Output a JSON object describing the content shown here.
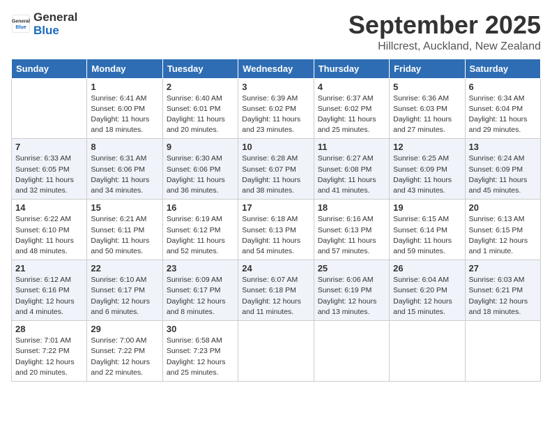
{
  "header": {
    "logo_general": "General",
    "logo_blue": "Blue",
    "month": "September 2025",
    "location": "Hillcrest, Auckland, New Zealand"
  },
  "weekdays": [
    "Sunday",
    "Monday",
    "Tuesday",
    "Wednesday",
    "Thursday",
    "Friday",
    "Saturday"
  ],
  "weeks": [
    [
      {
        "day": "",
        "text": ""
      },
      {
        "day": "1",
        "text": "Sunrise: 6:41 AM\nSunset: 6:00 PM\nDaylight: 11 hours\nand 18 minutes."
      },
      {
        "day": "2",
        "text": "Sunrise: 6:40 AM\nSunset: 6:01 PM\nDaylight: 11 hours\nand 20 minutes."
      },
      {
        "day": "3",
        "text": "Sunrise: 6:39 AM\nSunset: 6:02 PM\nDaylight: 11 hours\nand 23 minutes."
      },
      {
        "day": "4",
        "text": "Sunrise: 6:37 AM\nSunset: 6:02 PM\nDaylight: 11 hours\nand 25 minutes."
      },
      {
        "day": "5",
        "text": "Sunrise: 6:36 AM\nSunset: 6:03 PM\nDaylight: 11 hours\nand 27 minutes."
      },
      {
        "day": "6",
        "text": "Sunrise: 6:34 AM\nSunset: 6:04 PM\nDaylight: 11 hours\nand 29 minutes."
      }
    ],
    [
      {
        "day": "7",
        "text": "Sunrise: 6:33 AM\nSunset: 6:05 PM\nDaylight: 11 hours\nand 32 minutes."
      },
      {
        "day": "8",
        "text": "Sunrise: 6:31 AM\nSunset: 6:06 PM\nDaylight: 11 hours\nand 34 minutes."
      },
      {
        "day": "9",
        "text": "Sunrise: 6:30 AM\nSunset: 6:06 PM\nDaylight: 11 hours\nand 36 minutes."
      },
      {
        "day": "10",
        "text": "Sunrise: 6:28 AM\nSunset: 6:07 PM\nDaylight: 11 hours\nand 38 minutes."
      },
      {
        "day": "11",
        "text": "Sunrise: 6:27 AM\nSunset: 6:08 PM\nDaylight: 11 hours\nand 41 minutes."
      },
      {
        "day": "12",
        "text": "Sunrise: 6:25 AM\nSunset: 6:09 PM\nDaylight: 11 hours\nand 43 minutes."
      },
      {
        "day": "13",
        "text": "Sunrise: 6:24 AM\nSunset: 6:09 PM\nDaylight: 11 hours\nand 45 minutes."
      }
    ],
    [
      {
        "day": "14",
        "text": "Sunrise: 6:22 AM\nSunset: 6:10 PM\nDaylight: 11 hours\nand 48 minutes."
      },
      {
        "day": "15",
        "text": "Sunrise: 6:21 AM\nSunset: 6:11 PM\nDaylight: 11 hours\nand 50 minutes."
      },
      {
        "day": "16",
        "text": "Sunrise: 6:19 AM\nSunset: 6:12 PM\nDaylight: 11 hours\nand 52 minutes."
      },
      {
        "day": "17",
        "text": "Sunrise: 6:18 AM\nSunset: 6:13 PM\nDaylight: 11 hours\nand 54 minutes."
      },
      {
        "day": "18",
        "text": "Sunrise: 6:16 AM\nSunset: 6:13 PM\nDaylight: 11 hours\nand 57 minutes."
      },
      {
        "day": "19",
        "text": "Sunrise: 6:15 AM\nSunset: 6:14 PM\nDaylight: 11 hours\nand 59 minutes."
      },
      {
        "day": "20",
        "text": "Sunrise: 6:13 AM\nSunset: 6:15 PM\nDaylight: 12 hours\nand 1 minute."
      }
    ],
    [
      {
        "day": "21",
        "text": "Sunrise: 6:12 AM\nSunset: 6:16 PM\nDaylight: 12 hours\nand 4 minutes."
      },
      {
        "day": "22",
        "text": "Sunrise: 6:10 AM\nSunset: 6:17 PM\nDaylight: 12 hours\nand 6 minutes."
      },
      {
        "day": "23",
        "text": "Sunrise: 6:09 AM\nSunset: 6:17 PM\nDaylight: 12 hours\nand 8 minutes."
      },
      {
        "day": "24",
        "text": "Sunrise: 6:07 AM\nSunset: 6:18 PM\nDaylight: 12 hours\nand 11 minutes."
      },
      {
        "day": "25",
        "text": "Sunrise: 6:06 AM\nSunset: 6:19 PM\nDaylight: 12 hours\nand 13 minutes."
      },
      {
        "day": "26",
        "text": "Sunrise: 6:04 AM\nSunset: 6:20 PM\nDaylight: 12 hours\nand 15 minutes."
      },
      {
        "day": "27",
        "text": "Sunrise: 6:03 AM\nSunset: 6:21 PM\nDaylight: 12 hours\nand 18 minutes."
      }
    ],
    [
      {
        "day": "28",
        "text": "Sunrise: 7:01 AM\nSunset: 7:22 PM\nDaylight: 12 hours\nand 20 minutes."
      },
      {
        "day": "29",
        "text": "Sunrise: 7:00 AM\nSunset: 7:22 PM\nDaylight: 12 hours\nand 22 minutes."
      },
      {
        "day": "30",
        "text": "Sunrise: 6:58 AM\nSunset: 7:23 PM\nDaylight: 12 hours\nand 25 minutes."
      },
      {
        "day": "",
        "text": ""
      },
      {
        "day": "",
        "text": ""
      },
      {
        "day": "",
        "text": ""
      },
      {
        "day": "",
        "text": ""
      }
    ]
  ]
}
